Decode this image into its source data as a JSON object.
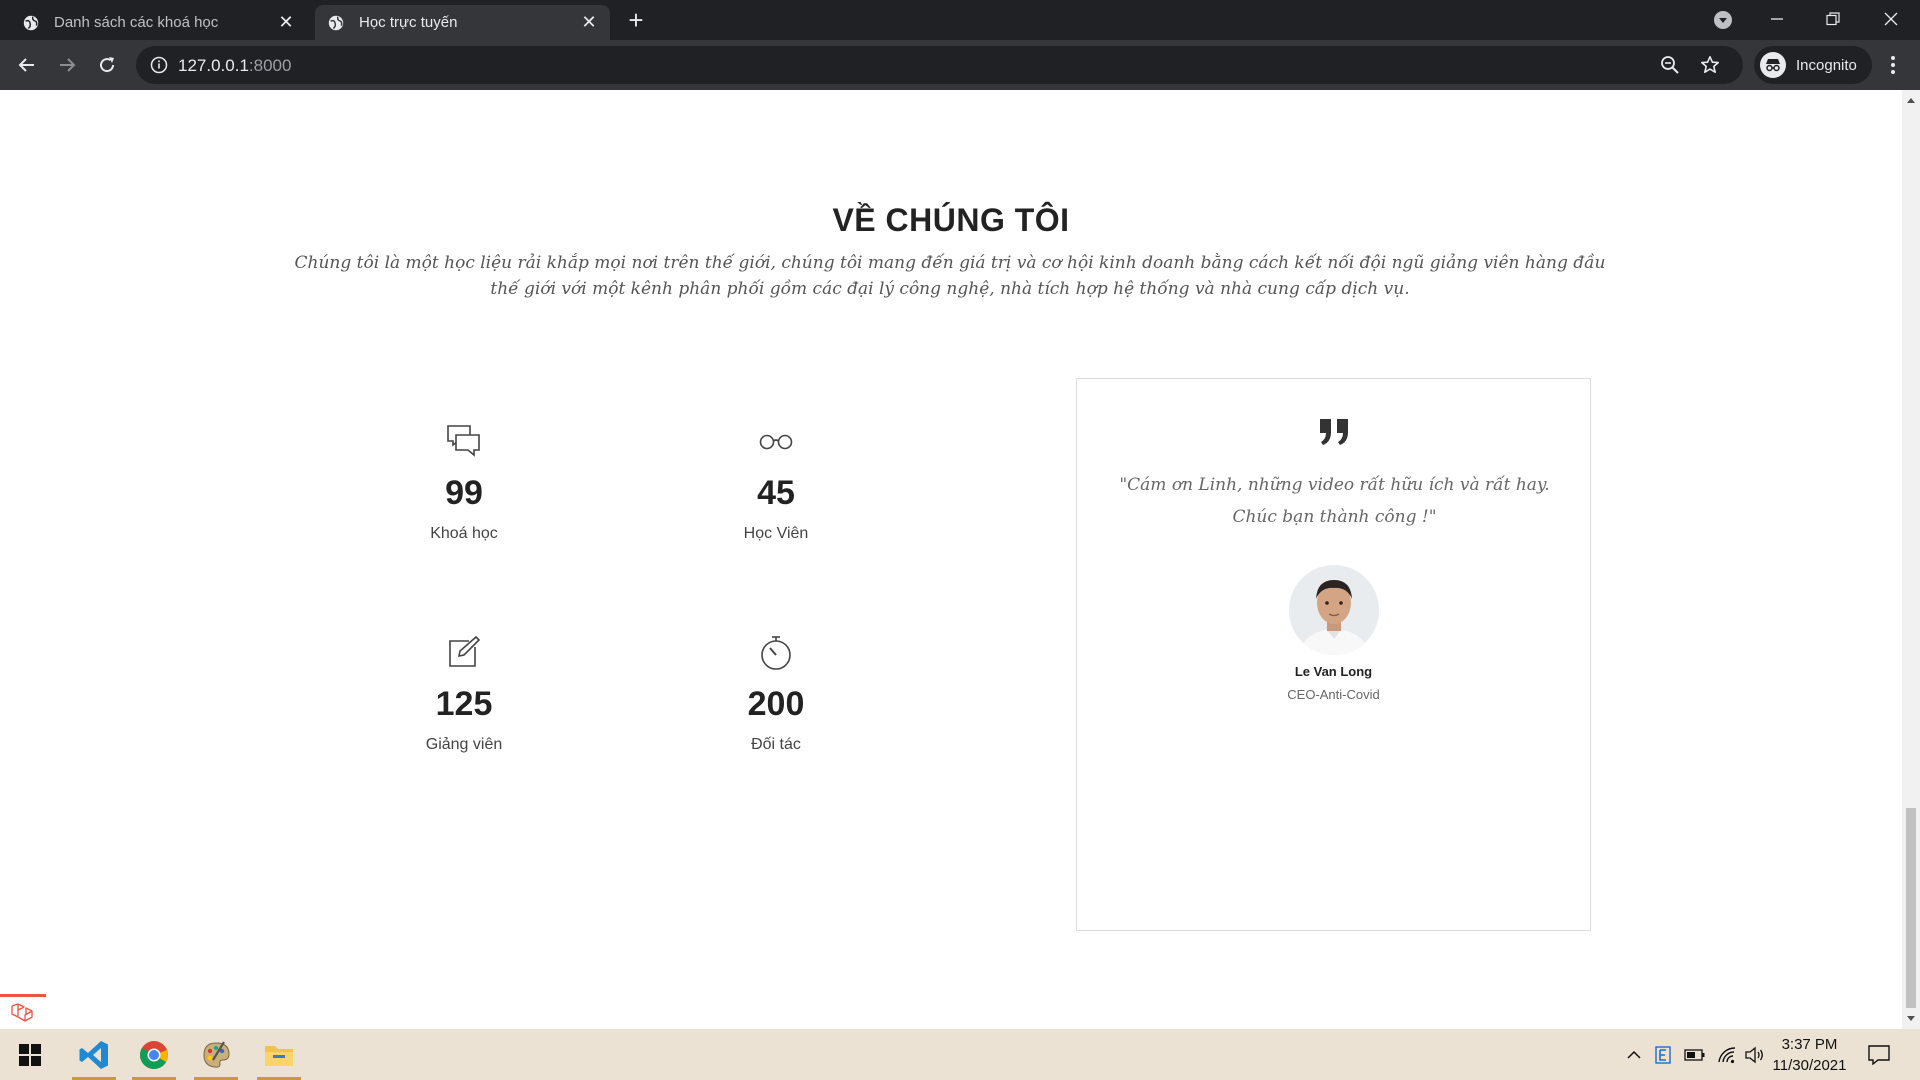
{
  "browser": {
    "tabs": [
      {
        "title": "Danh sách các khoá học",
        "active": false
      },
      {
        "title": "Học trực tuyến",
        "active": true
      }
    ],
    "url": {
      "host": "127.0.0.1",
      "port": ":8000"
    },
    "profile_label": "Incognito"
  },
  "about": {
    "title": "VỀ CHÚNG TÔI",
    "description": "Chúng tôi là một học liệu rải khắp mọi nơi trên thế giới, chúng tôi mang đến giá trị và cơ hội kinh doanh bằng cách kết nối đội ngũ giảng viên hàng đầu thế giới với một kênh phân phối gồm các đại lý công nghệ, nhà tích hợp hệ thống và nhà cung cấp dịch vụ.",
    "stats": [
      {
        "icon": "chat-bubbles-icon",
        "value": "99",
        "label": "Khoá học"
      },
      {
        "icon": "glasses-icon",
        "value": "45",
        "label": "Học Viên"
      },
      {
        "icon": "edit-icon",
        "value": "125",
        "label": "Giảng viên"
      },
      {
        "icon": "stopwatch-icon",
        "value": "200",
        "label": "Đối tác"
      }
    ]
  },
  "testimonial": {
    "quote": "\"Cám ơn Linh, những video rất hữu ích và rất hay. Chúc bạn thành công !\"",
    "author": "Le Van Long",
    "role": "CEO-Anti-Covid"
  },
  "taskbar": {
    "time": "3:37 PM",
    "date": "11/30/2021"
  }
}
